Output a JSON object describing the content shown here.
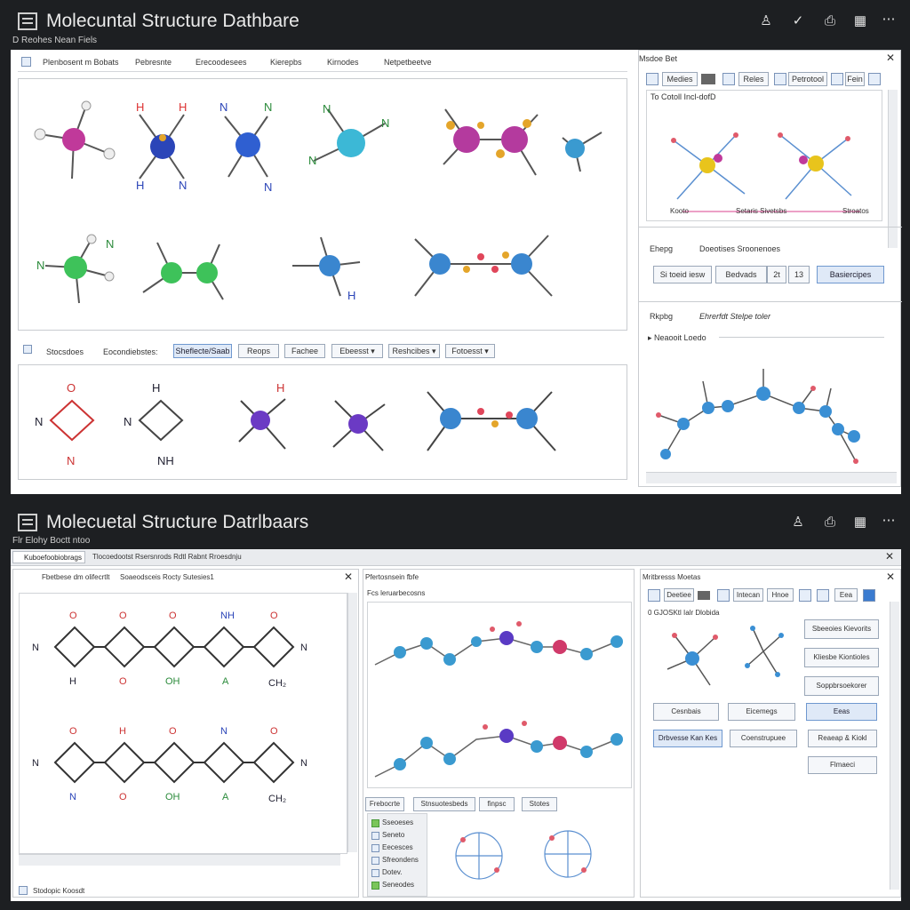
{
  "top": {
    "title": "Molecuntal Structure Dathbare",
    "subtitle": "D  Reohes  Nean  Fiels",
    "tabs": [
      "Plenbosent m Bobats",
      "Pebresnte",
      "Erecoodesees",
      "Kierepbs",
      "Kirnodes",
      "Netpetbeetve"
    ],
    "filter_label_1": "Stocsdoes",
    "filter_label_2": "Eocondiebstes:",
    "filters": [
      "Sheflecte/Saab",
      "Reops",
      "Fachee",
      "Ebeesst",
      "Reshcibes",
      "Fotoesst"
    ],
    "right_title": "Msdoe Bet",
    "right_tabs": [
      "Medies",
      "Reles",
      "Petrotool",
      "Fein"
    ],
    "right_header_label": "To Cotoll Incl-dofD",
    "right_caption_left": "Kooto",
    "right_caption_mid": "Setaris  Sivetsbs",
    "right_caption_right": "Stroatos",
    "section1_label": "Ehepg",
    "section1_title": "Doeotises Sroonenoes",
    "section1_buttons": [
      "Si toeid iesw",
      "Bedvads",
      "2t",
      "13",
      "Basiercipes"
    ],
    "section2_label": "Rkpbg",
    "section2_title": "Ehrerfdt Stelpe toler",
    "section2_sub": "Neaooit Loedo"
  },
  "bottom": {
    "title": "Molecuetal Structure Datrlbaars",
    "subtitle": "Flr  Elohy  Boctt  ntoo",
    "tab_active": "Kuboefoobiobrags",
    "tab_rest": "Tlocoedootst  Rsersnrods  Rdtl  Rabnt Rroesdnju",
    "left_title": "Fbetbese  dm olifecrtlt",
    "left_subtitle": "Soaeodsceis  Rocty Sutesies1",
    "left_footer": "Stodopic Koosdt",
    "mid_title": "Pfertosnsein fbfe",
    "mid_subtitle": "Fcs leruarbecosns",
    "mid_buttons": [
      "Frebocrte",
      "Stnsuotesbeds",
      "finpsc",
      "Stotes"
    ],
    "mid_list": [
      "Sseoeses",
      "Seneto",
      "Eecesces",
      "Sfreondens",
      "Dotev.",
      "Seneodes"
    ],
    "right_title": "Mritbresss  Moetas",
    "right_tabs": [
      "Deetiee",
      "Intecan",
      "Hnoe",
      "Eea"
    ],
    "right_header_label": "0 GJOSKtl Ialr Dlobida",
    "right_buttons": [
      "Sbeeoies Kievorits",
      "Kliesbe Kiontioles",
      "Soppbrsoekorer",
      "Cesnbais",
      "Eicemegs",
      "Eeas",
      "Drbvesse Kan Kes",
      "Coenstrupuee",
      "Reaeap & Kiokl",
      "Flmaeci"
    ]
  }
}
